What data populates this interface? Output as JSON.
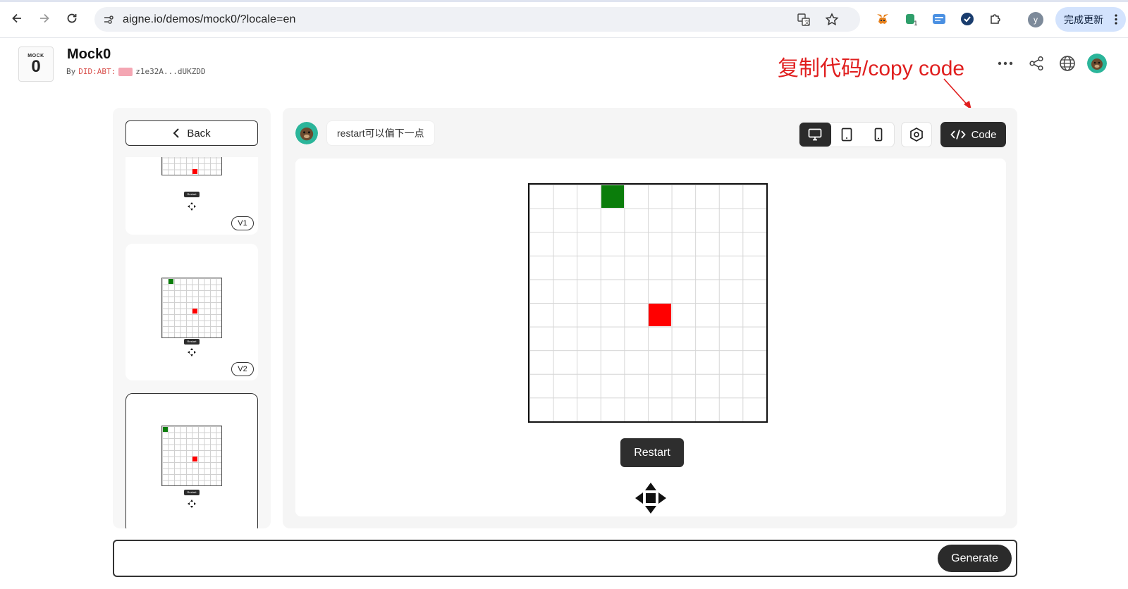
{
  "browser": {
    "url": "aigne.io/demos/mock0/?locale=en",
    "profile_initial": "y",
    "update_label": "完成更新",
    "extension_badge": "1"
  },
  "app": {
    "logo_top": "MOCK",
    "logo_digit": "0",
    "title": "Mock0",
    "by_label": "By",
    "did_label": "DID:ABT:",
    "did_value": "z1e32A...dUKZDD"
  },
  "annotation": {
    "text": "复制代码/copy code",
    "color": "#e01e1e"
  },
  "sidebar": {
    "back_label": "Back",
    "versions": [
      {
        "label": "V1",
        "selected": false
      },
      {
        "label": "V2",
        "selected": false
      },
      {
        "label": "",
        "selected": true
      }
    ],
    "thumb_button_label": "Restart"
  },
  "toolbar": {
    "prompt_text": "restart可以偏下一点",
    "code_label": "Code",
    "devices": [
      "desktop-icon",
      "tablet-icon",
      "mobile-icon"
    ],
    "active_device": "desktop"
  },
  "game": {
    "grid_size": 10,
    "snake_cell": {
      "col": 3,
      "row": 0
    },
    "food_cell": {
      "col": 5,
      "row": 5
    },
    "snake_color": "#0b7d0b",
    "food_color": "#ff0000",
    "restart_label": "Restart"
  },
  "composer": {
    "placeholder": "",
    "generate_label": "Generate"
  }
}
